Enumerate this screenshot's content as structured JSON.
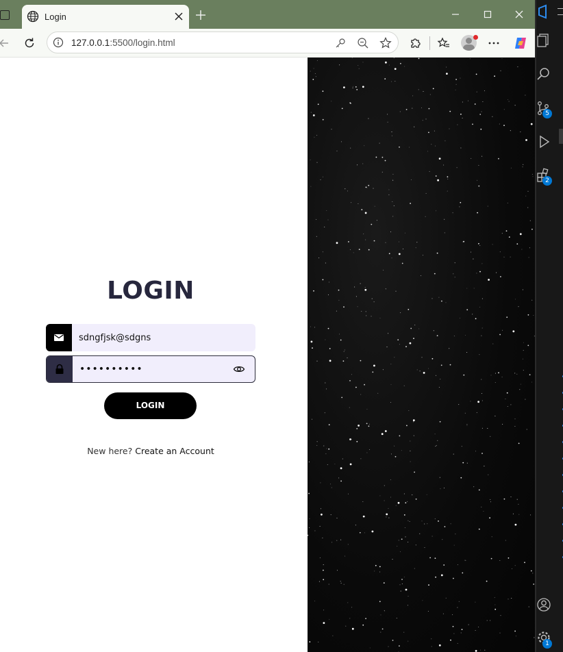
{
  "browser": {
    "tab_title": "Login",
    "url_host": "127.0.0.1",
    "url_rest": ":5500/login.html"
  },
  "login": {
    "title": "LOGIN",
    "email_value": "sdngfjsk@sdgns",
    "password_value": "••••••••••",
    "button_label": "LOGIN",
    "signup_prefix": "New here?",
    "signup_link": "Create an Account"
  },
  "vscode": {
    "badges": [
      "5",
      "2",
      "1"
    ]
  },
  "colors": {
    "title_bar": "#6a7f5e",
    "heading": "#27273d",
    "field_bg": "#f1eefc",
    "accent_badge": "#0078d4"
  }
}
